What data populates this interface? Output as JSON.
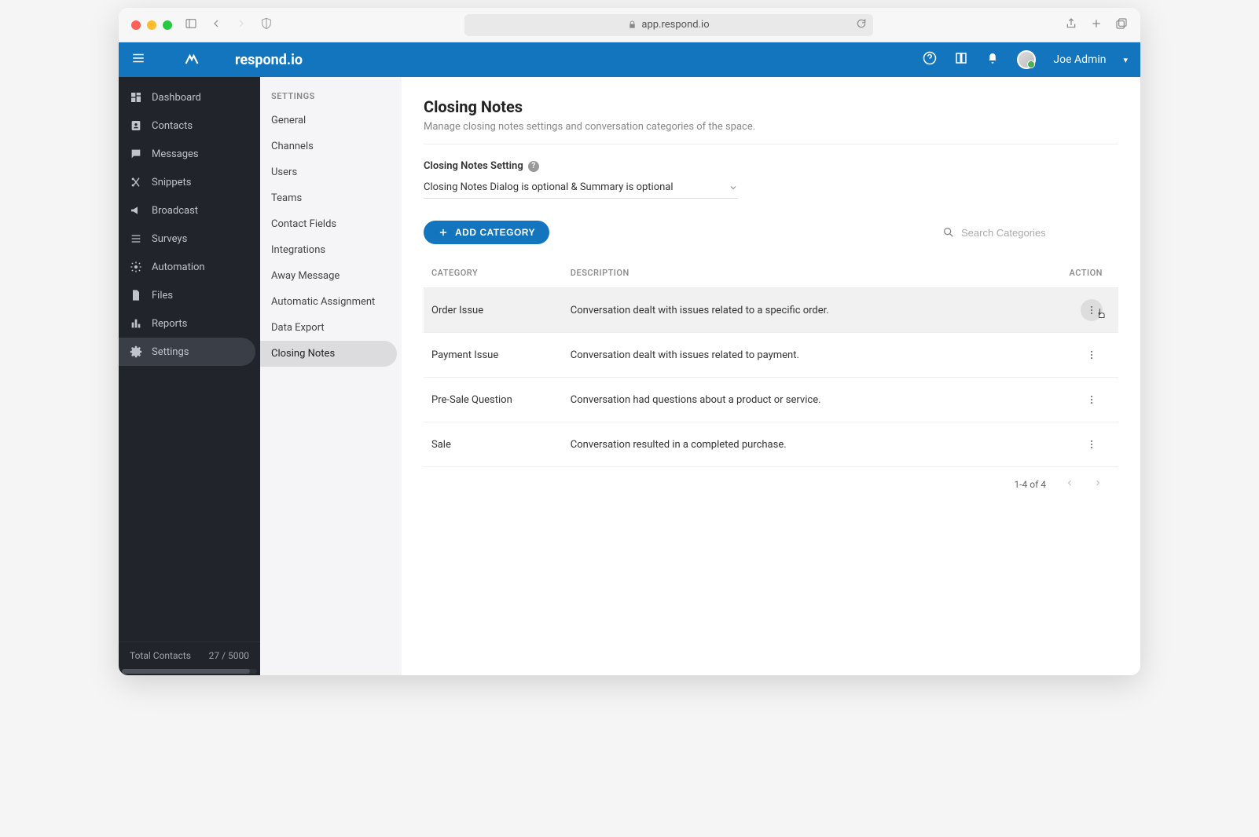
{
  "browser": {
    "url": "app.respond.io"
  },
  "brand": "respond.io",
  "header": {
    "user_name": "Joe Admin"
  },
  "left_nav": {
    "items": [
      {
        "label": "Dashboard",
        "icon": "dashboard"
      },
      {
        "label": "Contacts",
        "icon": "contacts"
      },
      {
        "label": "Messages",
        "icon": "messages"
      },
      {
        "label": "Snippets",
        "icon": "snippets"
      },
      {
        "label": "Broadcast",
        "icon": "broadcast"
      },
      {
        "label": "Surveys",
        "icon": "surveys"
      },
      {
        "label": "Automation",
        "icon": "automation"
      },
      {
        "label": "Files",
        "icon": "files"
      },
      {
        "label": "Reports",
        "icon": "reports"
      },
      {
        "label": "Settings",
        "icon": "settings",
        "active": true
      }
    ],
    "footer_left": "Total Contacts",
    "footer_right": "27 / 5000"
  },
  "settings_nav": {
    "title": "SETTINGS",
    "items": [
      {
        "label": "General"
      },
      {
        "label": "Channels"
      },
      {
        "label": "Users"
      },
      {
        "label": "Teams"
      },
      {
        "label": "Contact Fields"
      },
      {
        "label": "Integrations"
      },
      {
        "label": "Away Message"
      },
      {
        "label": "Automatic Assignment"
      },
      {
        "label": "Data Export"
      },
      {
        "label": "Closing Notes",
        "active": true
      }
    ]
  },
  "main": {
    "title": "Closing Notes",
    "subtitle": "Manage closing notes settings and conversation categories of the space.",
    "setting_label": "Closing Notes Setting",
    "setting_value": "Closing Notes Dialog is optional & Summary is optional",
    "add_button": "ADD CATEGORY",
    "search_placeholder": "Search Categories",
    "table": {
      "headers": {
        "category": "CATEGORY",
        "description": "DESCRIPTION",
        "action": "ACTION"
      },
      "rows": [
        {
          "category": "Order Issue",
          "description": "Conversation dealt with issues related to a specific order.",
          "highlight": true
        },
        {
          "category": "Payment Issue",
          "description": "Conversation dealt with issues related to payment."
        },
        {
          "category": "Pre-Sale Question",
          "description": "Conversation had questions about a product or service."
        },
        {
          "category": "Sale",
          "description": "Conversation resulted in a completed purchase."
        }
      ]
    },
    "pagination": "1-4 of 4"
  }
}
